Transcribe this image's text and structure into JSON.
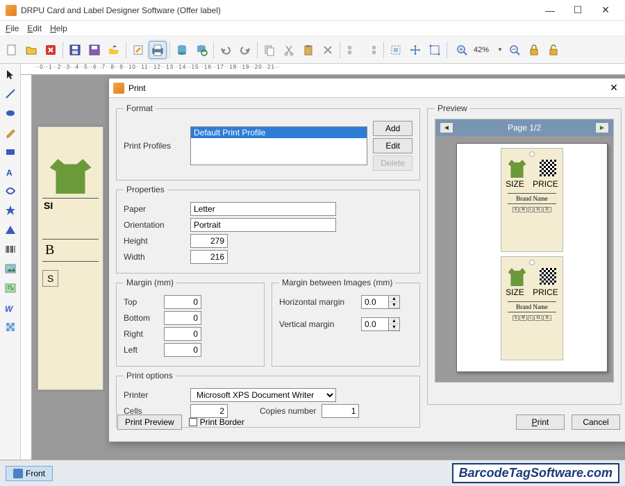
{
  "window": {
    "title": "DRPU Card and Label Designer Software (Offer label)"
  },
  "menu": {
    "file": "File",
    "edit": "Edit",
    "help": "Help"
  },
  "toolbar": {
    "zoom_pct": "42%"
  },
  "dialog": {
    "title": "Print",
    "format": {
      "legend": "Format",
      "profiles_label": "Print Profiles",
      "profile_selected": "Default Print Profile",
      "add": "Add",
      "edit": "Edit",
      "delete": "Delete"
    },
    "properties": {
      "legend": "Properties",
      "paper_label": "Paper",
      "paper_value": "Letter",
      "orientation_label": "Orientation",
      "orientation_value": "Portrait",
      "height_label": "Height",
      "height_value": "279",
      "width_label": "Width",
      "width_value": "216"
    },
    "margin": {
      "legend": "Margin (mm)",
      "top_label": "Top",
      "top_value": "0",
      "bottom_label": "Bottom",
      "bottom_value": "0",
      "right_label": "Right",
      "right_value": "0",
      "left_label": "Left",
      "left_value": "0"
    },
    "margin_between": {
      "legend": "Margin between Images (mm)",
      "h_label": "Horizontal margin",
      "h_value": "0.0",
      "v_label": "Vertical margin",
      "v_value": "0.0"
    },
    "print_options": {
      "legend": "Print options",
      "printer_label": "Printer",
      "printer_value": "Microsoft XPS Document Writer",
      "cells_label": "Cells",
      "cells_value": "2",
      "copies_label": "Copies number",
      "copies_value": "1"
    },
    "footer": {
      "preview_btn": "Print Preview",
      "border_chk": "Print Border",
      "print_btn": "Print",
      "cancel_btn": "Cancel"
    },
    "preview": {
      "legend": "Preview",
      "page_indicator": "Page 1/2",
      "tag": {
        "size": "SIZE",
        "price": "PRICE",
        "brand": "Brand Name",
        "sizes": [
          "S",
          "M",
          "L",
          "XL",
          "2L"
        ]
      }
    }
  },
  "canvas": {
    "front_tab": "Front",
    "card_text1": "SI",
    "card_text2": "B",
    "card_text3": "S"
  },
  "footer": {
    "brand": "BarcodeTagSoftware.com"
  },
  "ruler": "··0··1··2··3··4··5··6··7··8··9··10··11··12··13··14··15··16··17··18··19··20··21··"
}
